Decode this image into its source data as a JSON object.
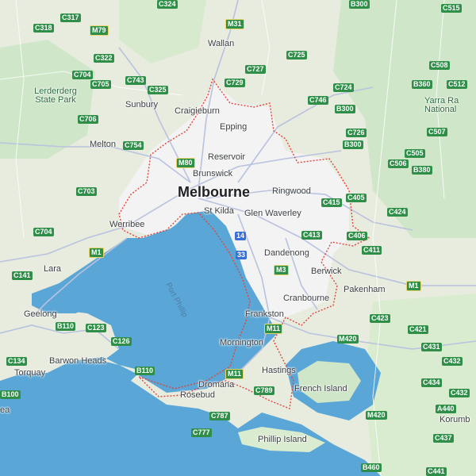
{
  "map": {
    "colors": {
      "land": "#e8ecdf",
      "park": "#cfe6c8",
      "water": "#5aa6d6",
      "urban": "#f3f3f3",
      "road": "#b9c2de",
      "boundary": "#e0443a"
    },
    "labels": {
      "melbourne": "Melbourne",
      "wallan": "Wallan",
      "sunbury": "Sunbury",
      "craigieburn": "Craigieburn",
      "epping": "Epping",
      "melton": "Melton",
      "reservoir": "Reservoir",
      "brunswick": "Brunswick",
      "ringwood": "Ringwood",
      "st_kilda": "St Kilda",
      "glen_waverley": "Glen Waverley",
      "werribee": "Werribee",
      "dandenong": "Dandenong",
      "berwick": "Berwick",
      "pakenham": "Pakenham",
      "lara": "Lara",
      "geelong": "Geelong",
      "cranbourne": "Cranbourne",
      "frankston": "Frankston",
      "torquay": "Torquay",
      "barwon_heads": "Barwon Heads",
      "mornington": "Mornington",
      "hastings": "Hastings",
      "dromana": "Dromana",
      "rosebud": "Rosebud",
      "french_island": "French Island",
      "phillip_island": "Phillip Island",
      "lerderderg": "Lerderderg State Park",
      "yarra_ranges": "Yarra Ra National",
      "korumburra": "Korumb",
      "port_phillip": "Port Phillip",
      "lea": "ea"
    },
    "shields": {
      "c317": "C317",
      "c318": "C318",
      "m79": "M79",
      "c324": "C324",
      "m31": "M31",
      "b300a": "B300",
      "c515": "C515",
      "c322": "C322",
      "c704a": "C704",
      "c705": "C705",
      "c743": "C743",
      "c325": "C325",
      "c725": "C725",
      "c727": "C727",
      "c729": "C729",
      "c724": "C724",
      "c508": "C508",
      "b360": "B360",
      "c512": "C512",
      "c706": "C706",
      "c746": "C746",
      "b300b": "B300",
      "c754": "C754",
      "c726": "C726",
      "b300c": "B300",
      "c507": "C507",
      "m80": "M80",
      "c505": "C505",
      "c506": "C506",
      "b380": "B380",
      "c703": "C703",
      "c405": "C405",
      "c415": "C415",
      "c424": "C424",
      "c704b": "C704",
      "m1a": "M1",
      "c413": "C413",
      "c406": "C406",
      "c411": "C411",
      "c141": "C141",
      "m3": "M3",
      "m1b": "M1",
      "c423": "C423",
      "c421": "C421",
      "b110a": "B110",
      "c123": "C123",
      "m11": "M11",
      "c126": "C126",
      "m420a": "M420",
      "c431": "C431",
      "c134": "C134",
      "c432": "C432",
      "b110b": "B110",
      "c434": "C434",
      "m11b": "M11",
      "c789": "C789",
      "c100": "B100",
      "c432b": "C432",
      "a440": "A440",
      "c787": "C787",
      "m420b": "M420",
      "c777": "C777",
      "c437": "C437",
      "b460": "B460",
      "c441": "C441",
      "f14": "14",
      "f33": "33"
    }
  }
}
